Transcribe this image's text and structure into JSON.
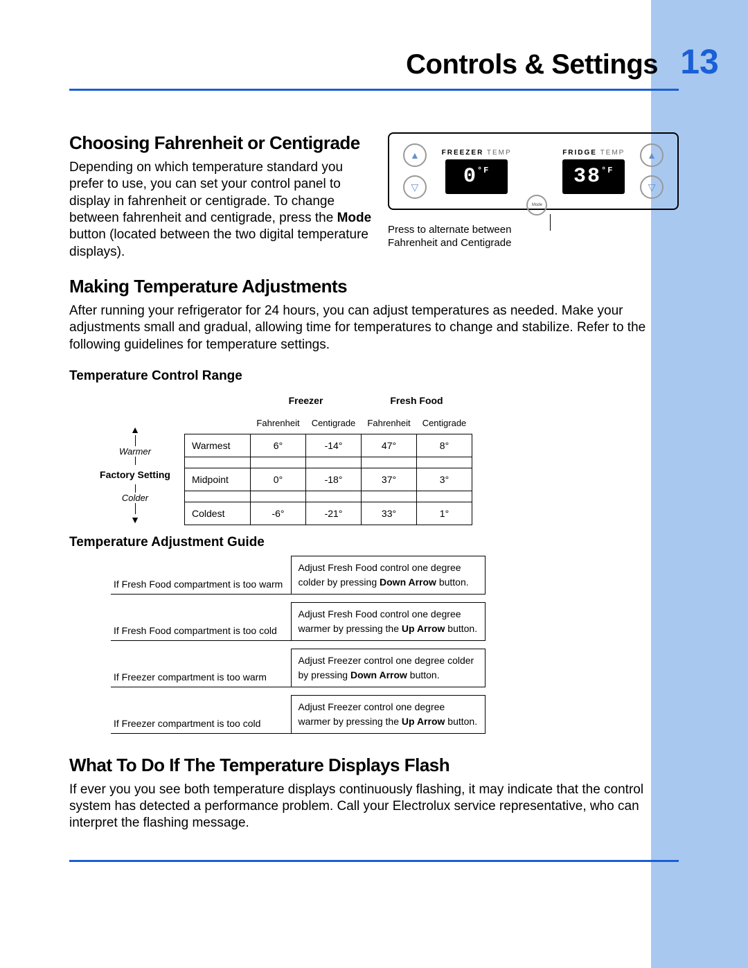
{
  "header": {
    "title": "Controls & Settings",
    "page_number": "13"
  },
  "section1": {
    "heading": "Choosing Fahrenheit or Centigrade",
    "para_before_bold": "Depending on which temperature standard you prefer to use, you can set your control panel to display in fahrenheit or centigrade. To change between fahrenheit and centigrade, press the ",
    "bold_word": "Mode",
    "para_after_bold": " button (located between the two digital temperature displays)."
  },
  "panel": {
    "freezer_label_bold": "FREEZER",
    "freezer_label_rest": " TEMP",
    "fridge_label_bold": "FRIDGE",
    "fridge_label_rest": " TEMP",
    "freezer_display": "0",
    "freezer_unit": "°F",
    "fridge_display": "38",
    "fridge_unit": "°F",
    "mode_label": "Mode",
    "caption": "Press to alternate between Fahrenheit and Centigrade"
  },
  "section2": {
    "heading": "Making Temperature Adjustments",
    "para": "After running your refrigerator for 24 hours, you can adjust temperatures as needed. Make your adjustments small and gradual, allowing time for temperatures to change and stabilize. Refer to the following guidelines for temperature settings."
  },
  "range": {
    "heading": "Temperature Control Range",
    "group_headers": {
      "freezer": "Freezer",
      "fresh": "Fresh Food"
    },
    "sub_headers": {
      "f": "Fahrenheit",
      "c": "Centigrade"
    },
    "left_labels": {
      "warmer": "Warmer",
      "factory": "Factory Setting",
      "colder": "Colder"
    },
    "rows": [
      {
        "label": "Warmest",
        "ff": "6°",
        "fc": "-14°",
        "rf": "47°",
        "rc": "8°"
      },
      {
        "label": "Midpoint",
        "ff": "0°",
        "fc": "-18°",
        "rf": "37°",
        "rc": "3°"
      },
      {
        "label": "Coldest",
        "ff": "-6°",
        "fc": "-21°",
        "rf": "33°",
        "rc": "1°"
      }
    ]
  },
  "adjust": {
    "heading": "Temperature Adjustment Guide",
    "rows": [
      {
        "cond": "If Fresh Food compartment is too warm",
        "act_before": "Adjust Fresh Food control one degree colder by pressing ",
        "act_bold": "Down Arrow",
        "act_after": " button."
      },
      {
        "cond": "If Fresh Food compartment is too cold",
        "act_before": "Adjust Fresh Food control one degree warmer by pressing the ",
        "act_bold": "Up Arrow",
        "act_after": " button."
      },
      {
        "cond": "If Freezer compartment is too warm",
        "act_before": "Adjust Freezer control one degree colder by pressing ",
        "act_bold": "Down Arrow",
        "act_after": " button."
      },
      {
        "cond": "If Freezer compartment is too cold",
        "act_before": "Adjust Freezer control one degree warmer by pressing the ",
        "act_bold": "Up Arrow",
        "act_after": " button."
      }
    ]
  },
  "section3": {
    "heading": "What To Do If The Temperature Displays Flash",
    "para": "If ever you you see both temperature displays continuously flashing, it may indicate that the control system has detected a performance problem. Call your Electrolux service representative, who can interpret the flashing message."
  }
}
